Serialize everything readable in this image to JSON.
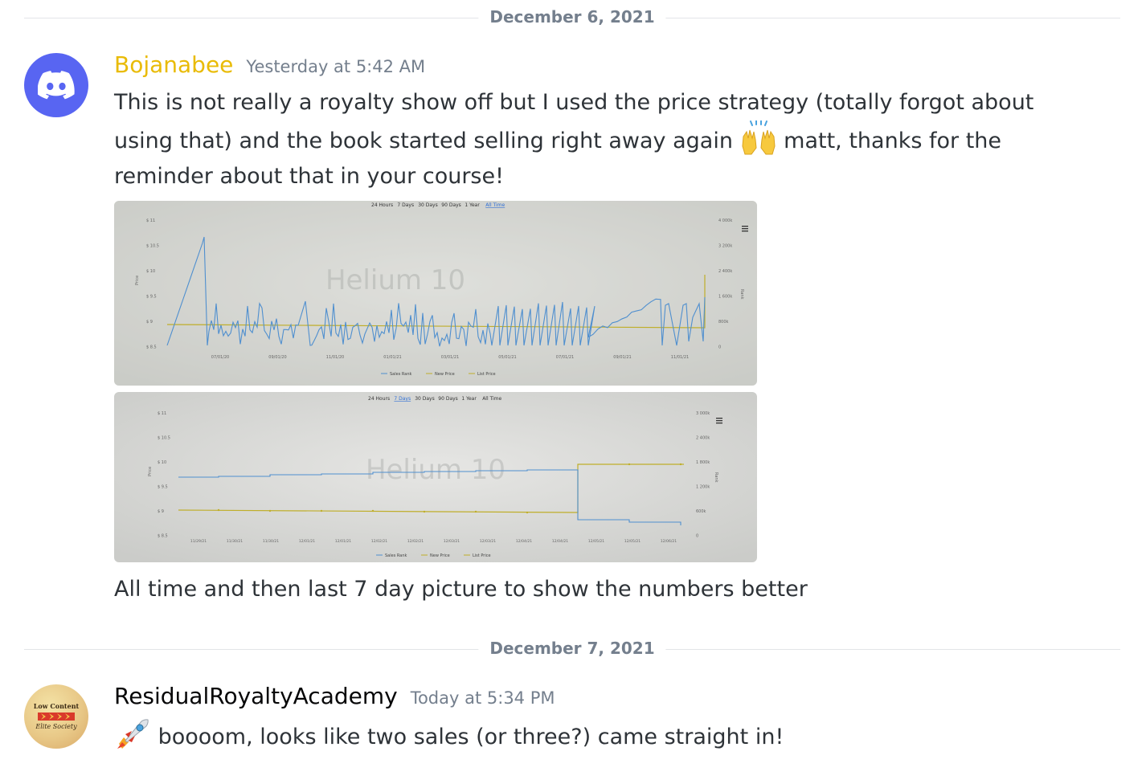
{
  "dividers": [
    {
      "label": "December 6, 2021"
    },
    {
      "label": "December 7, 2021"
    }
  ],
  "messages": [
    {
      "username": "Bojanabee",
      "timestamp": "Yesterday at 5:42 AM",
      "line1": "This is not really a royalty show off but I used the price strategy (totally forgot about",
      "line2_before_emoji": "using that) and the book started selling right away again",
      "line2_after_emoji": "matt, thanks for the",
      "line3": "reminder about that in your course!",
      "emoji": "raising-hands-emoji",
      "caption": "All time and then last 7 day picture to show the numbers better"
    },
    {
      "username": "ResidualRoyaltyAcademy",
      "timestamp": "Today at 5:34 PM",
      "emoji": "rocket-emoji",
      "text": "boooom, looks like two sales (or three?) came straight in!",
      "avatar_line1": "Low Content",
      "avatar_line2": "Elite Society"
    }
  ],
  "photo1": {
    "tabs": [
      "24 Hours",
      "7 Days",
      "30 Days",
      "90 Days",
      "1 Year",
      "All Time"
    ],
    "active_tab": "All Time",
    "watermark": "Helium 10",
    "y_left_ticks": [
      "$ 11",
      "$ 10.5",
      "$ 10",
      "$ 9.5",
      "$ 9",
      "$ 8.5"
    ],
    "y_right_ticks": [
      "4 000k",
      "3 200k",
      "2 400k",
      "1 600k",
      "800k",
      "0"
    ],
    "x_ticks": [
      "07/01/20",
      "09/01/20",
      "11/01/20",
      "01/01/21",
      "03/01/21",
      "05/01/21",
      "07/01/21",
      "09/01/21",
      "11/01/21"
    ],
    "y_left_label": "Price",
    "y_right_label": "Rank",
    "legend": [
      "Sales Rank",
      "New Price",
      "List Price"
    ]
  },
  "photo2": {
    "tabs": [
      "24 Hours",
      "7 Days",
      "30 Days",
      "90 Days",
      "1 Year",
      "All Time"
    ],
    "active_tab": "7 Days",
    "watermark": "Helium 10",
    "y_left_ticks": [
      "$ 11",
      "$ 10.5",
      "$ 10",
      "$ 9.5",
      "$ 9",
      "$ 8.5"
    ],
    "y_right_ticks": [
      "3 000k",
      "2 400k",
      "1 800k",
      "1 200k",
      "600k",
      "0"
    ],
    "x_ticks": [
      "11/29/21",
      "11/30/21",
      "11/30/21",
      "12/01/21",
      "12/01/21",
      "12/02/21",
      "12/02/21",
      "12/03/21",
      "12/03/21",
      "12/04/21",
      "12/04/21",
      "12/05/21",
      "12/05/21",
      "12/06/21"
    ],
    "y_left_label": "Price",
    "y_right_label": "Rank",
    "legend": [
      "Sales Rank",
      "New Price",
      "List Price"
    ]
  },
  "colors": {
    "username_gold": "#e9bb06",
    "discord_blurple": "#5865f2",
    "rank_line": "#4f8fcf",
    "price_line": "#bfae2a"
  }
}
